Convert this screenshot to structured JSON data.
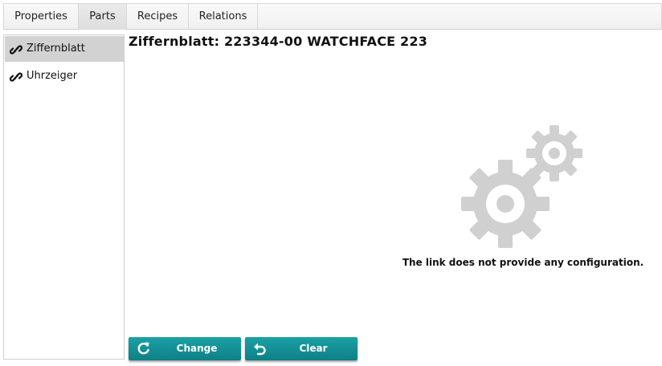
{
  "tabs": [
    {
      "label": "Properties",
      "active": false
    },
    {
      "label": "Parts",
      "active": true
    },
    {
      "label": "Recipes",
      "active": false
    },
    {
      "label": "Relations",
      "active": false
    }
  ],
  "sidebar": {
    "items": [
      {
        "label": "Ziffernblatt",
        "icon": "link-icon",
        "selected": true
      },
      {
        "label": "Uhrzeiger",
        "icon": "link-icon",
        "selected": false
      }
    ]
  },
  "main": {
    "title": "Ziffernblatt: 223344-00 WATCHFACE 223",
    "illustration": "gears-icon",
    "message": "The link does not provide any configuration."
  },
  "actions": {
    "change_label": "Change",
    "change_icon": "refresh-icon",
    "clear_label": "Clear",
    "clear_icon": "undo-icon"
  },
  "colors": {
    "button": "#128e92",
    "selected_item": "#d2d2d2",
    "gears": "#d0d0d0"
  }
}
